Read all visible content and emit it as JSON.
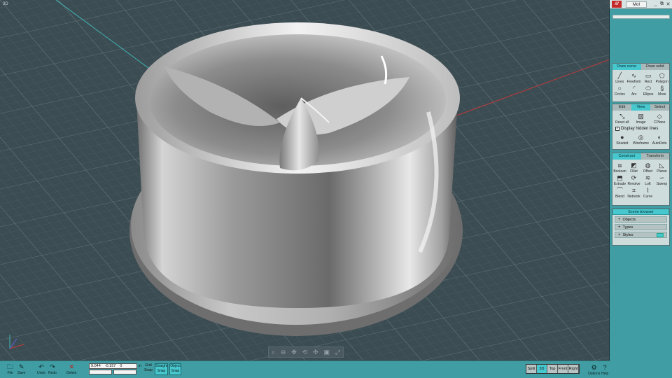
{
  "viewport": {
    "label": "3D"
  },
  "titlebar": {
    "app_name": "MoI",
    "logo": "moi-logo",
    "buttons": [
      "_",
      "⧉",
      "✕"
    ]
  },
  "draw_curve": {
    "tabs": [
      "Draw curve",
      "Draw solid"
    ],
    "active_tab": "Draw curve",
    "tools": [
      "Lines",
      "Freeform",
      "Rect",
      "Polygon",
      "Circles",
      "Arc",
      "Ellipse",
      "More"
    ]
  },
  "view": {
    "tabs": [
      "Edit",
      "View",
      "Select"
    ],
    "active_tab": "View",
    "tools": [
      "Reset all",
      "Image",
      "CPlane"
    ],
    "display_hidden_lines": "Display hidden lines",
    "display_hidden_lines_checked": true,
    "modes": [
      "Shaded",
      "Wireframe",
      "AutoRoto"
    ]
  },
  "construct": {
    "tabs": [
      "Construct",
      "Transform"
    ],
    "active_tab": "Construct",
    "tools": [
      "Boolean",
      "Fillet",
      "Offset",
      "Planar",
      "Extrude",
      "Revolve",
      "Loft",
      "Sweep",
      "Blend",
      "Network",
      "Curve"
    ]
  },
  "scene_browser": {
    "title": "Scene browser",
    "rows": [
      "Objects",
      "Types",
      "Styles"
    ]
  },
  "bottom": {
    "file": "File",
    "save": "Save",
    "undo": "Undo",
    "redo": "Redo",
    "delete": "Delete",
    "coord_x": "9.044",
    "coord_y": "-0.157",
    "coord_z": "0",
    "unit": "in",
    "grid": "Grid",
    "snap": "Snap",
    "straight_snap_top": "Straight",
    "straight_snap_bottom": "Snap",
    "object_snap_top": "Object",
    "object_snap_bottom": "Snap",
    "views": [
      "Split",
      "3D",
      "Top",
      "Front",
      "Right"
    ],
    "active_view": "3D",
    "options": "Options",
    "help": "Help"
  },
  "colors": {
    "accent": "#47c8cf",
    "panel": "#3f9da3",
    "viewport_bg": "#3c4c53"
  }
}
